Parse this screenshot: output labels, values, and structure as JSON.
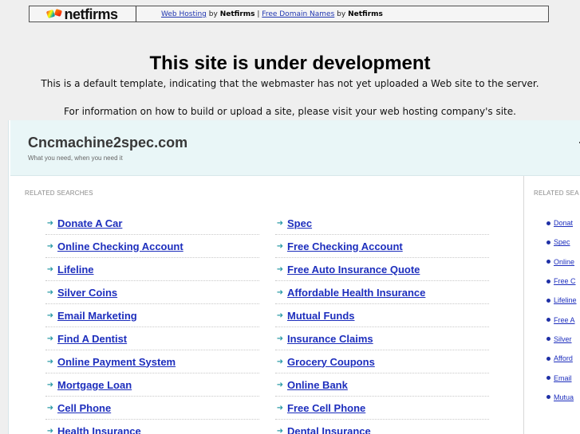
{
  "top_banner": {
    "brand": "netfirms",
    "link_1": "Web Hosting",
    "by_1": "by",
    "strong_1": "Netfirms",
    "separator": "|",
    "link_2": "Free Domain Names",
    "by_2": "by",
    "strong_2": "Netfirms"
  },
  "notice": {
    "title": "This site is under development",
    "line_1": "This is a default template, indicating that the webmaster has not yet uploaded a Web site to the server.",
    "line_2": "For information on how to build or upload a site, please visit your web hosting company's site."
  },
  "site": {
    "name": "Cncmachine2spec.com",
    "tagline": "What you need, when you need it"
  },
  "left_related": {
    "title": "RELATED SEARCHES",
    "left_items": [
      "Donate A Car",
      "Online Checking Account",
      "Lifeline",
      "Silver Coins",
      "Email Marketing",
      "Find A Dentist",
      "Online Payment System",
      "Mortgage Loan",
      "Cell Phone",
      "Health Insurance"
    ],
    "right_items": [
      "Spec",
      "Free Checking Account",
      "Free Auto Insurance Quote",
      "Affordable Health Insurance",
      "Mutual Funds",
      "Insurance Claims",
      "Grocery Coupons",
      "Online Bank",
      "Free Cell Phone",
      "Dental Insurance"
    ]
  },
  "right_related": {
    "title": "RELATED SEA",
    "items": [
      "Donat",
      "Spec",
      "Online",
      "Free C",
      "Lifeline",
      "Free A",
      "Silver",
      "Afford",
      "Email",
      "Mutua"
    ]
  }
}
